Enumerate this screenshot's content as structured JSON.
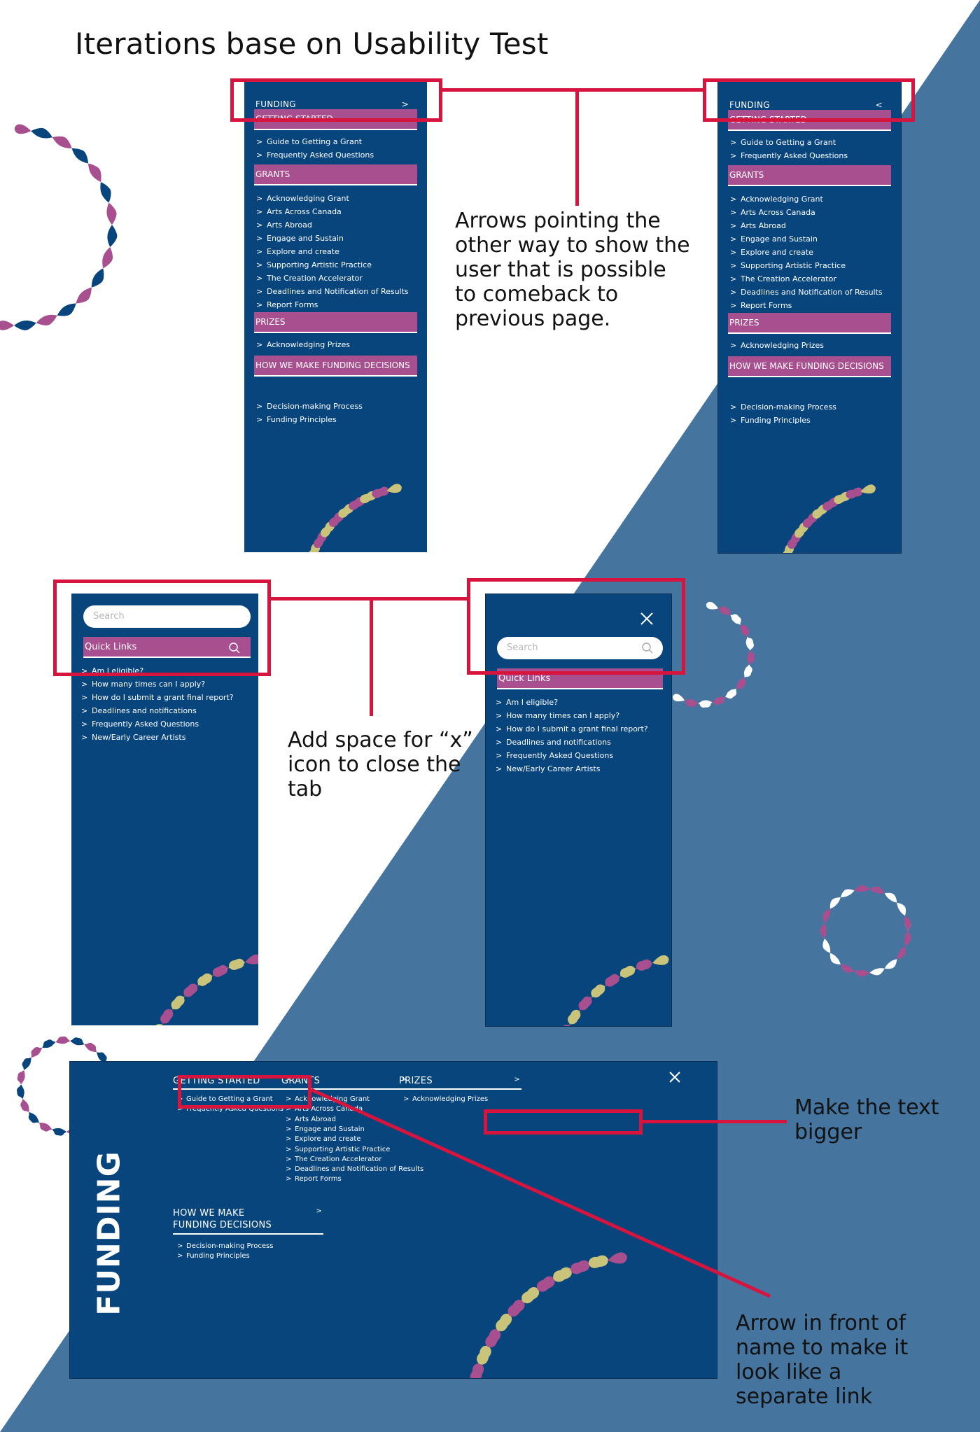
{
  "page_title": "Iterations base on Usability Test",
  "annotations": {
    "arrows": "Arrows pointing the other way to show the user that is possible to comeback to previous page.",
    "close_space": "Add space for “x” icon to close the tab",
    "text_bigger": "Make the text bigger",
    "arrow_front": "Arrow in front of name to make it look like a separate link"
  },
  "colors": {
    "panel": "#08457d",
    "section": "#a74f8f",
    "highlight": "#d7143e",
    "bg_triangle": "#45759f"
  },
  "funding_menu": {
    "header": "FUNDING",
    "header_arrow_before": ">",
    "header_arrow_after": "<",
    "sections": [
      {
        "title": "GETTING STARTED",
        "links": [
          "Guide to Getting a Grant",
          "Frequently Asked Questions"
        ]
      },
      {
        "title": "GRANTS",
        "links": [
          "Acknowledging Grant",
          "Arts Across Canada",
          "Arts Abroad",
          "Engage and Sustain",
          "Explore and create",
          "Supporting Artistic Practice",
          "The Creation Accelerator",
          "Deadlines and Notification of Results",
          "Report Forms"
        ]
      },
      {
        "title": "PRIZES",
        "links": [
          "Acknowledging Prizes"
        ]
      },
      {
        "title": "HOW WE MAKE FUNDING DECISIONS",
        "links": [
          "Decision-making Process",
          "Funding Principles"
        ]
      }
    ]
  },
  "search_menu": {
    "placeholder": "Search",
    "quick_links_label": "Quick Links",
    "links": [
      "Am I eligible?",
      "How many times can I apply?",
      "How do I submit a grant final report?",
      "Deadlines and notifications",
      "Frequently Asked Questions",
      "New/Early Career Artists"
    ]
  },
  "desktop_menu": {
    "vertical_title": "FUNDING",
    "columns": [
      {
        "title": "GETTING STARTED",
        "links": [
          "Guide to Getting a Grant",
          "Frequently Asked Questions"
        ]
      },
      {
        "title": "GRANTS",
        "links": [
          "Acknowledging Grant",
          "Arts Across Canada",
          "Arts Abroad",
          "Engage and Sustain",
          "Explore and create",
          "Supporting Artistic Practice",
          "The Creation Accelerator",
          "Deadlines and Notification of Results",
          "Report Forms"
        ]
      },
      {
        "title": "PRIZES",
        "links": [
          "Acknowledging Prizes"
        ]
      },
      {
        "title": "HOW WE MAKE FUNDING DECISIONS",
        "links": [
          "Decision-making Process",
          "Funding Principles"
        ]
      }
    ]
  },
  "chevron": ">"
}
